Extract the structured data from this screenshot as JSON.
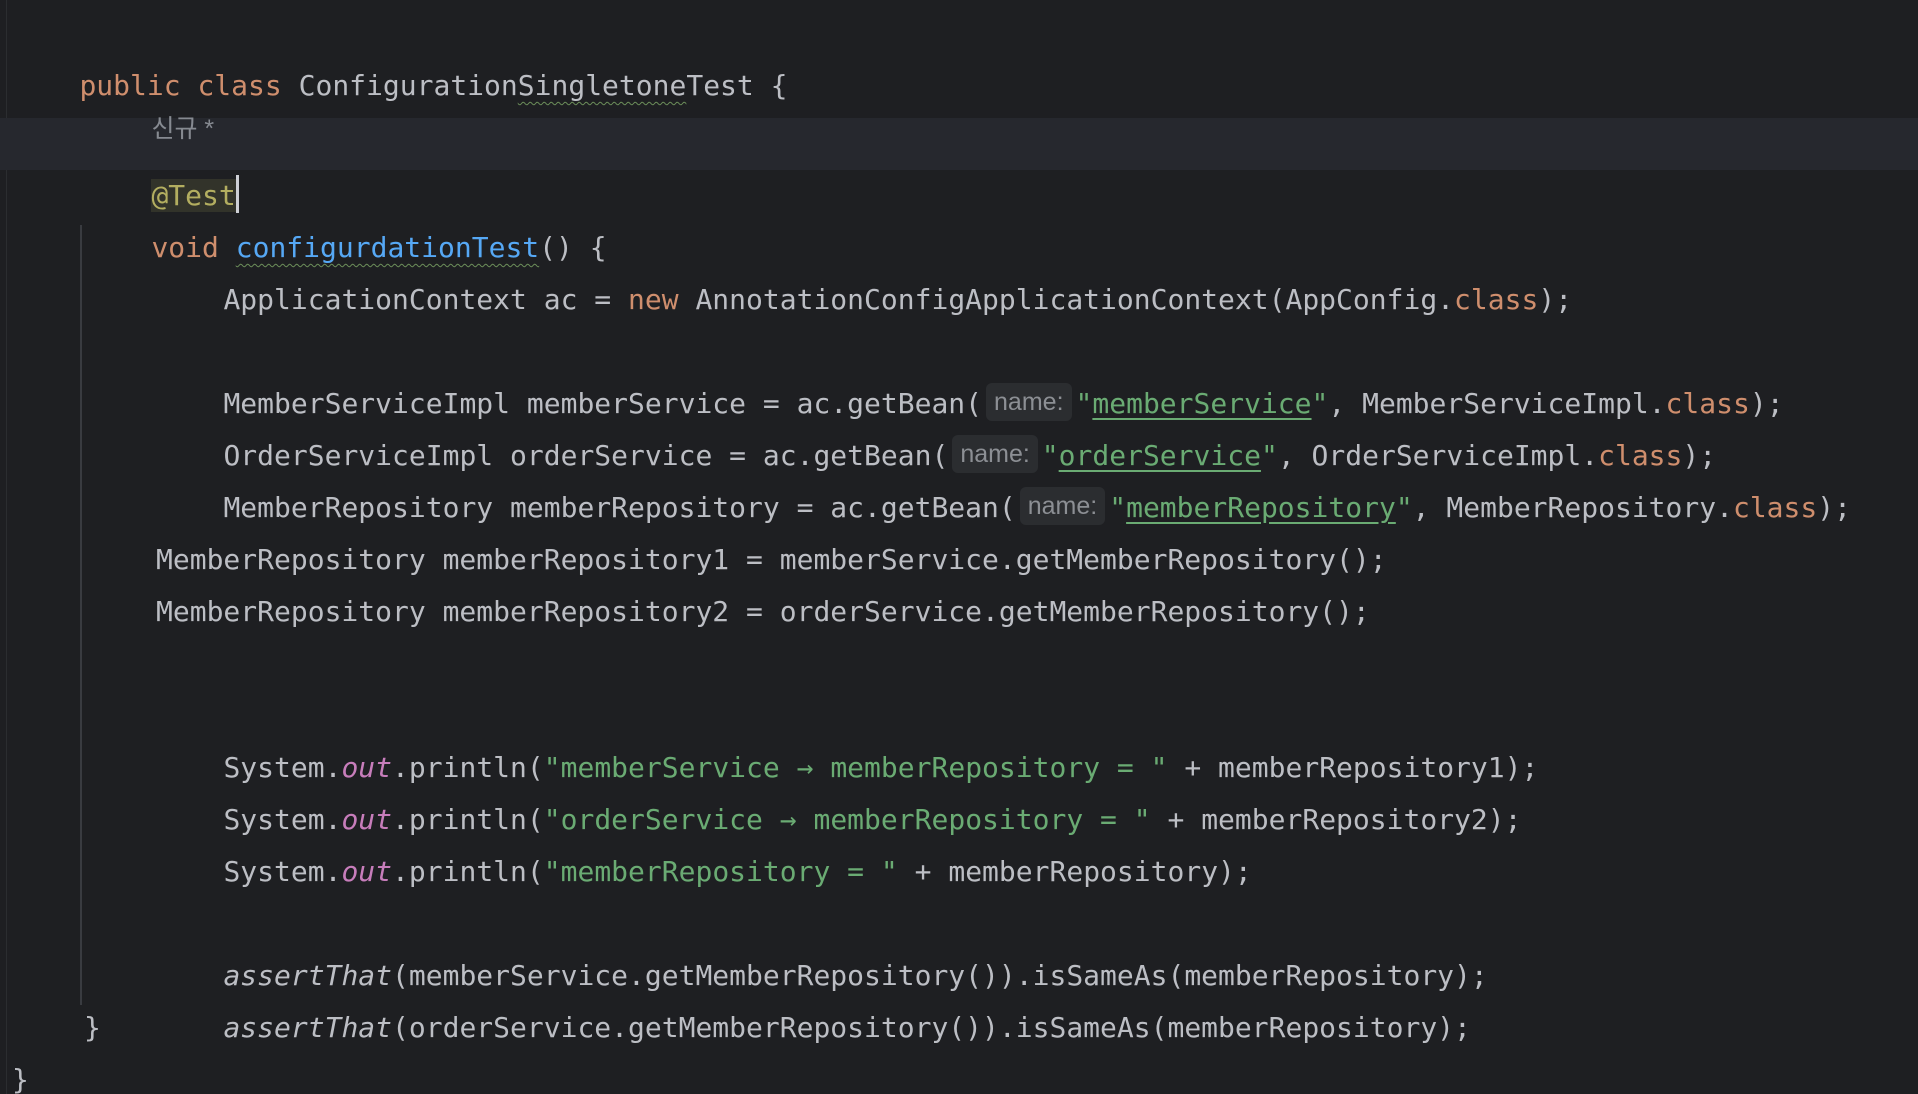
{
  "editor": {
    "class_line": {
      "kw_public": "public",
      "kw_class": "class",
      "name_pre": "Configuration",
      "name_squiggle": "Singletone",
      "name_post": "Test",
      "brace": " {"
    },
    "usage_hint": "신규 *",
    "annotation": "@Test",
    "method_line": {
      "kw_void": "void",
      "method_name": "configurdationTest",
      "rest": "() {"
    },
    "line_ac": {
      "pre": "ApplicationContext ac = ",
      "kw_new": "new",
      "mid": " AnnotationConfigApplicationContext(AppConfig.",
      "kw_class": "class",
      "end": ");"
    },
    "line_member_service": {
      "pre": "MemberServiceImpl memberService = ac.getBean(",
      "hint": "name:",
      "q1": "\"",
      "str": "memberService",
      "q2": "\"",
      "mid": ", MemberServiceImpl.",
      "kw_class": "class",
      "end": ");"
    },
    "line_order_service": {
      "pre": "OrderServiceImpl orderService = ac.getBean(",
      "hint": "name:",
      "q1": "\"",
      "str": "orderService",
      "q2": "\"",
      "mid": ", OrderServiceImpl.",
      "kw_class": "class",
      "end": ");"
    },
    "line_member_repo": {
      "pre": "MemberRepository memberRepository = ac.getBean(",
      "hint": "name:",
      "q1": "\"",
      "str": "memberRepository",
      "q2": "\"",
      "mid": ", MemberRepository.",
      "kw_class": "class",
      "end": ");"
    },
    "line_repo1": "MemberRepository memberRepository1 = memberService.getMemberRepository();",
    "line_repo2": "MemberRepository memberRepository2 = orderService.getMemberRepository();",
    "println1": {
      "pre": "System.",
      "field": "out",
      "call": ".println(",
      "q1": "\"",
      "str": "memberService → memberRepository = ",
      "q2": "\"",
      "end": " + memberRepository1);"
    },
    "println2": {
      "pre": "System.",
      "field": "out",
      "call": ".println(",
      "q1": "\"",
      "str": "orderService → memberRepository = ",
      "q2": "\"",
      "end": " + memberRepository2);"
    },
    "println3": {
      "pre": "System.",
      "field": "out",
      "call": ".println(",
      "q1": "\"",
      "str": "memberRepository = ",
      "q2": "\"",
      "end": " + memberRepository);"
    },
    "assert1": {
      "fn": "assertThat",
      "rest": "(memberService.getMemberRepository()).isSameAs(memberRepository);"
    },
    "assert2": {
      "fn": "assertThat",
      "rest": "(orderService.getMemberRepository()).isSameAs(memberRepository);"
    },
    "method_close": "}",
    "class_close": "}"
  },
  "colors": {
    "background": "#1e1f22",
    "keyword": "#cf8e6d",
    "annotation": "#b3ae60",
    "function": "#56a8f5",
    "string": "#6aab73",
    "static_field": "#c77dbb",
    "text": "#bcbec4"
  }
}
